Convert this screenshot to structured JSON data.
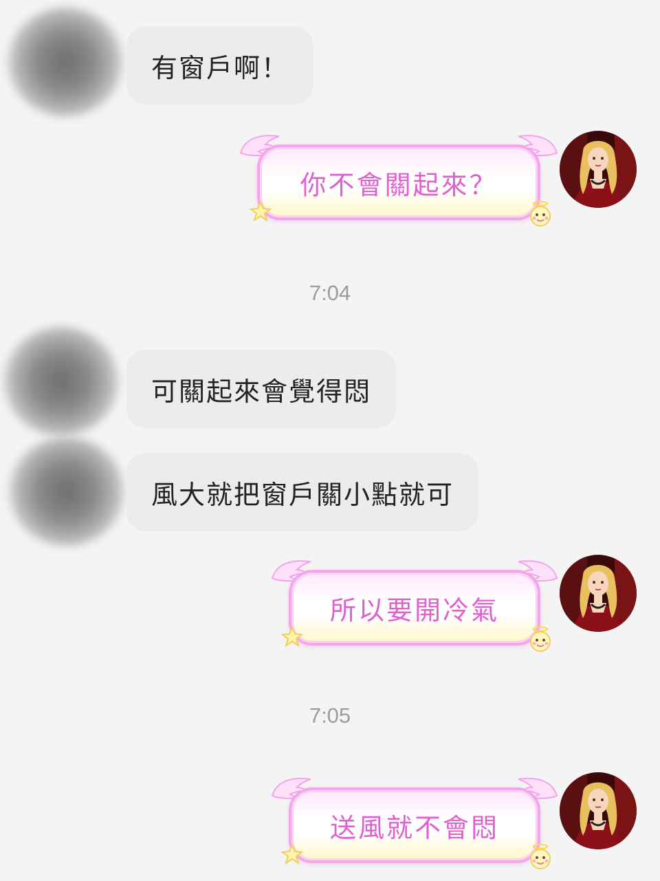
{
  "messages": [
    {
      "side": "in",
      "text": "有窗戶啊！"
    },
    {
      "side": "out",
      "text": "你不會關起來？"
    },
    {
      "side": "time",
      "text": "7:04"
    },
    {
      "side": "in",
      "text": "可關起來會覺得悶"
    },
    {
      "side": "in",
      "text": "風大就把窗戶關小點就可"
    },
    {
      "side": "out",
      "text": "所以要開冷氣"
    },
    {
      "side": "time",
      "text": "7:05"
    },
    {
      "side": "out",
      "text": "送風就不會悶"
    }
  ],
  "colors": {
    "background": "#f4f4f4",
    "incoming_bubble": "#ececec",
    "incoming_text": "#222222",
    "outgoing_text": "#e060d0",
    "outgoing_border": "#f4a6ea",
    "timestamp": "#9c9c9c"
  },
  "icons": {
    "incoming_avatar": "blurred-avatar",
    "outgoing_avatar": "blonde-woman-avatar",
    "bubble_decoration": "angel-wings-sticker"
  }
}
